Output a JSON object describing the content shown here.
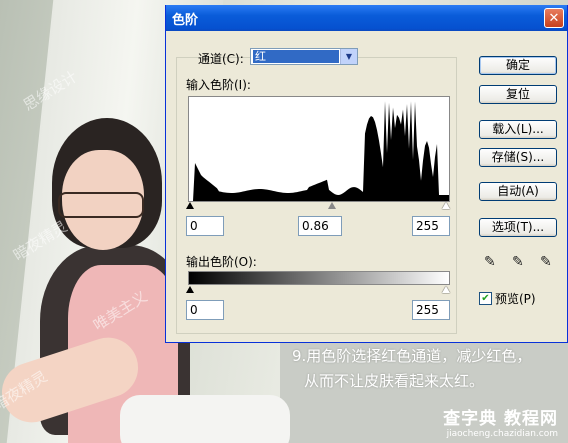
{
  "dialog": {
    "title": "色阶",
    "close_icon": "close-icon"
  },
  "channel": {
    "label": "通道(C):",
    "value": "红"
  },
  "input_levels": {
    "label": "输入色阶(I):",
    "black": "0",
    "gamma": "0.86",
    "white": "255"
  },
  "output_levels": {
    "label": "输出色阶(O):",
    "black": "0",
    "white": "255"
  },
  "buttons": {
    "ok": "确定",
    "reset": "复位",
    "load": "载入(L)...",
    "save": "存储(S)...",
    "auto": "自动(A)",
    "options": "选项(T)..."
  },
  "eyedroppers": [
    "black-eyedropper-icon",
    "gray-eyedropper-icon",
    "white-eyedropper-icon"
  ],
  "preview": {
    "label": "预览(P)",
    "checked": true
  },
  "caption": {
    "line1": "9.用色阶选择红色通道，减少红色，",
    "line2": "从而不让皮肤看起来太红。"
  },
  "site": {
    "name": "查字典 教程网",
    "url": "jiaocheng.chazidian.com"
  },
  "colors": {
    "titlebar": "#0a5cd9",
    "dialog_bg": "#ece9d8",
    "selection": "#316ac5"
  }
}
